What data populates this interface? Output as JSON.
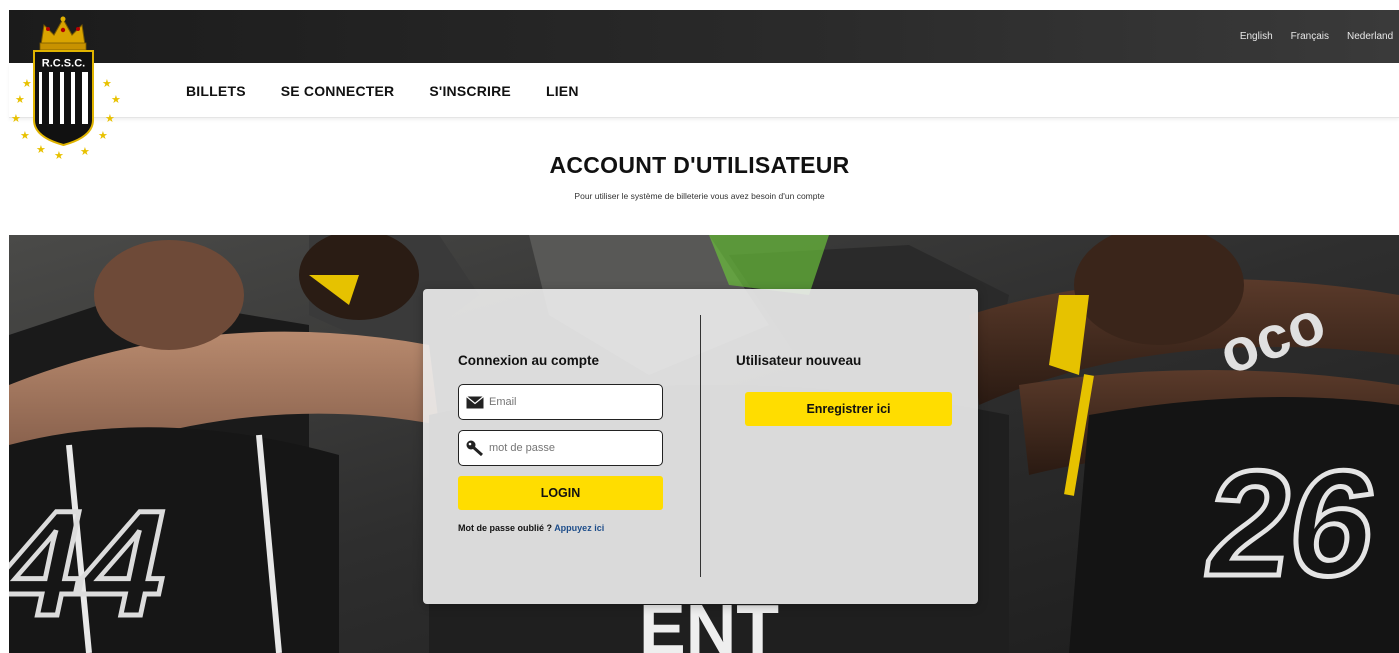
{
  "brand": {
    "logo_text": "R.C.S.C."
  },
  "languages": [
    "English",
    "Français",
    "Nederland"
  ],
  "nav": [
    "BILLETS",
    "SE CONNECTER",
    "S'INSCRIRE",
    "LIEN"
  ],
  "page": {
    "title": "ACCOUNT D'UTILISATEUR",
    "subtitle": "Pour utiliser le système de billeterie vous avez besoin d'un compte"
  },
  "login": {
    "title": "Connexion au compte",
    "email_placeholder": "Email",
    "password_placeholder": "mot de passe",
    "login_button": "LOGIN",
    "forgot_text": "Mot de passe oublié ?",
    "forgot_link": "Appuyez ici"
  },
  "register": {
    "title": "Utilisateur nouveau",
    "button": "Enregistrer ici"
  },
  "colors": {
    "accent": "#ffdd00",
    "topbar": "#222222",
    "link": "#1d4d8a"
  }
}
